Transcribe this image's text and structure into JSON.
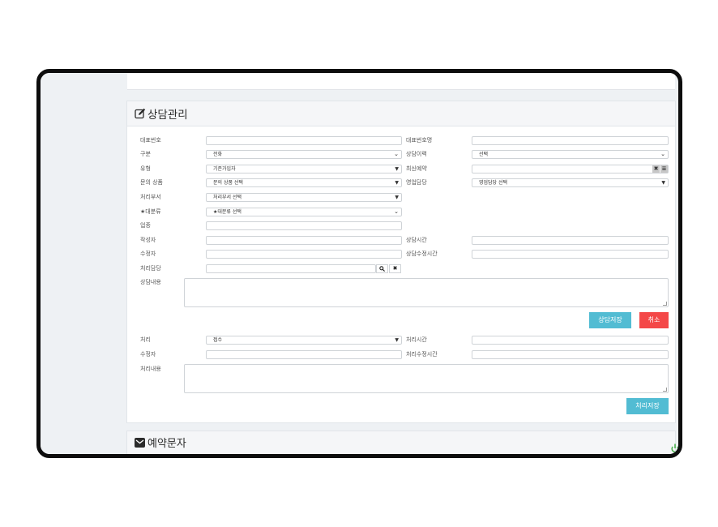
{
  "consult_panel": {
    "title": "상담관리",
    "labels": {
      "rep_number": "대표번호",
      "rep_number_name": "대표번호명",
      "category": "구분",
      "history": "상담이력",
      "type": "유형",
      "recent_reservation": "최신예약",
      "inquiry_product": "문의 상품",
      "sales_manager": "영업담당",
      "processing_dept": "처리부서",
      "major_category": "★대분류",
      "business": "업종",
      "writer": "작성자",
      "consult_time": "상담시간",
      "modifier": "수정자",
      "consult_modify_time": "상담수정시간",
      "processing_manager": "처리담당",
      "consult_content": "상담내용",
      "processing": "처리",
      "processing_time": "처리시간",
      "modifier2": "수정자",
      "processing_modify_time": "처리수정시간",
      "processing_content": "처리내용"
    },
    "selects": {
      "category": "전화",
      "history": "선택",
      "type": "기존가입자",
      "inquiry_product": "문의 상품 선택",
      "sales_manager": "영업담당 선택",
      "processing_dept": "처리부서 선택",
      "major_category": "★대분류 선택",
      "processing": "접수"
    },
    "buttons": {
      "save_consult": "상담저장",
      "cancel": "취소",
      "save_processing": "처리저장"
    }
  },
  "sms_panel": {
    "title": "예약문자"
  },
  "colors": {
    "accent": "#52bcd3",
    "danger": "#f44848"
  }
}
